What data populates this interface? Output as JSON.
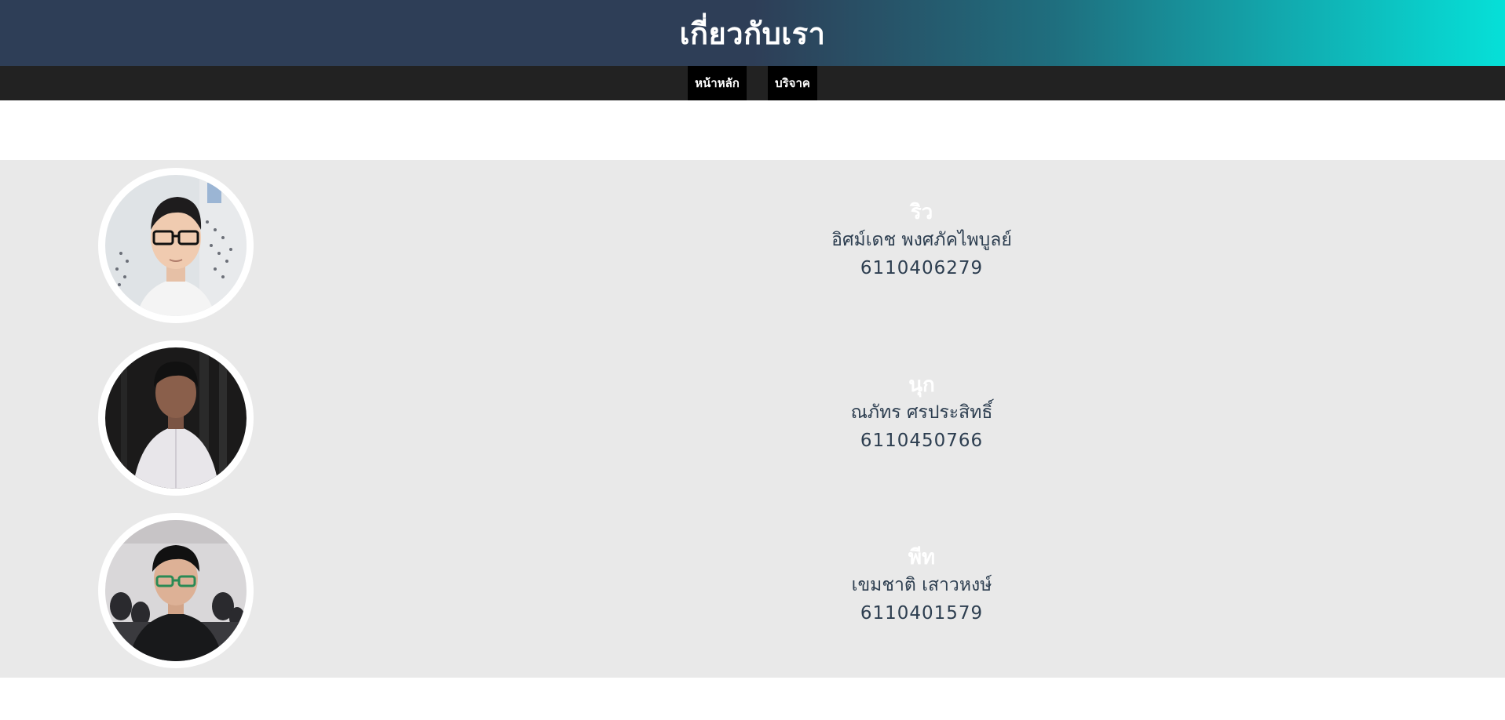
{
  "header": {
    "title": "เกี่ยวกับเรา"
  },
  "nav": {
    "items": [
      {
        "label": "หน้าหลัก"
      },
      {
        "label": "บริจาค"
      }
    ]
  },
  "members": [
    {
      "nickname": "ริว",
      "full_name": "อิศม์เดช พงศภัคไพบูลย์",
      "student_id": "6110406279"
    },
    {
      "nickname": "นุก",
      "full_name": "ณภัทร ศรประสิทธิ์",
      "student_id": "6110450766"
    },
    {
      "nickname": "พีท",
      "full_name": "เขมชาติ เสาวหงษ์",
      "student_id": "6110401579"
    }
  ],
  "colors": {
    "header_start": "#2e3e57",
    "header_end": "#06e0d8",
    "navbar": "#222222",
    "section_bg": "#e9e9e9",
    "text_dark": "#2d3e50"
  }
}
